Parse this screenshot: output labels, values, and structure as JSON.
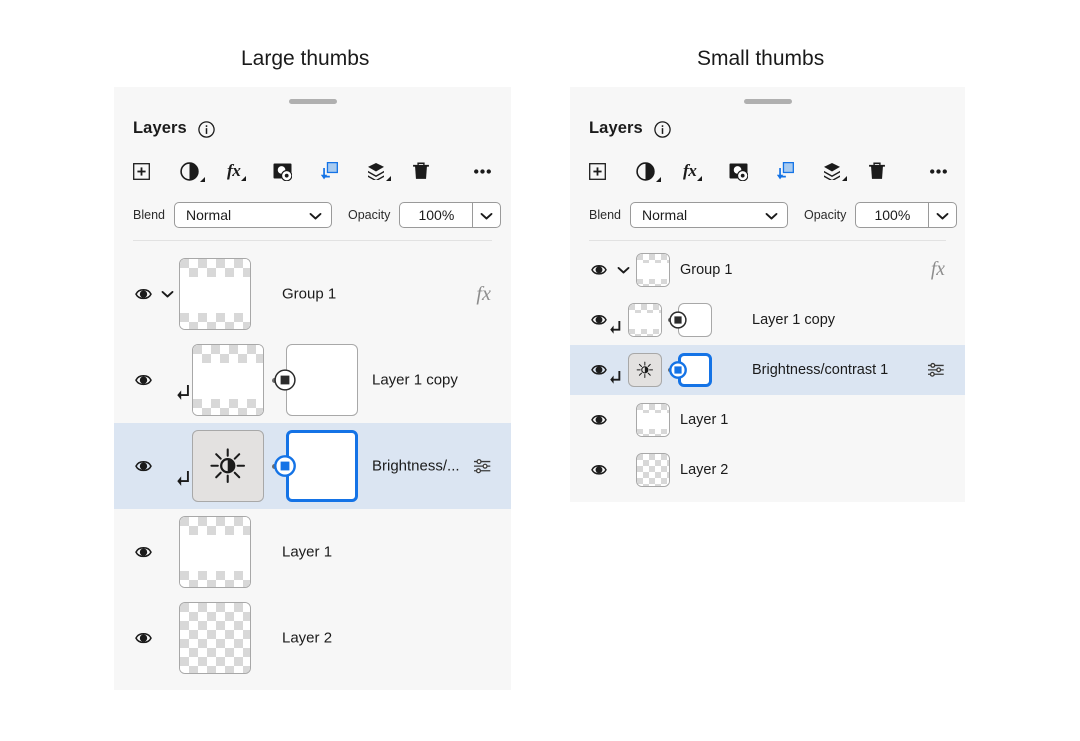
{
  "headings": {
    "large": "Large thumbs",
    "small": "Small thumbs"
  },
  "colors": {
    "panel_bg": "#f7f7f7",
    "selection": "#dbe5f2",
    "accent_blue": "#1473e6",
    "thumb_border": "#a8a8a8",
    "text": "#1b1b1b",
    "muted": "#8d8d8d"
  },
  "panel": {
    "title": "Layers",
    "info_icon": "info-circle-icon",
    "grabber": "drag-handle",
    "toolbar": [
      {
        "name": "add-layer-button",
        "icon": "plus-square-icon",
        "has_caret": false
      },
      {
        "name": "adjustment-layer-button",
        "icon": "half-circle-icon",
        "has_caret": true
      },
      {
        "name": "layer-effects-button",
        "icon": "fx-icon",
        "has_caret": true
      },
      {
        "name": "layer-mask-button",
        "icon": "mask-icon",
        "has_caret": false
      },
      {
        "name": "clipping-mask-button",
        "icon": "clip-square-icon",
        "has_caret": false
      },
      {
        "name": "group-layers-button",
        "icon": "stack-icon",
        "has_caret": true
      },
      {
        "name": "delete-layer-button",
        "icon": "trash-icon",
        "has_caret": false
      },
      {
        "name": "more-options-button",
        "icon": "ellipsis-icon",
        "has_caret": false
      }
    ],
    "properties": {
      "blend_label": "Blend",
      "blend_value": "Normal",
      "blend_options": [
        "Normal"
      ],
      "opacity_label": "Opacity",
      "opacity_value": "100%"
    }
  },
  "layers": [
    {
      "name": "Group 1",
      "visible": true,
      "visibility_icon": "eye-icon",
      "expanded": true,
      "expand_icon": "chevron-down-icon",
      "clipped": false,
      "thumb_type": "checker-frame",
      "has_mask": false,
      "mask_active": false,
      "selected": false,
      "right_icon": "fx-icon",
      "right_icon_label": "fx"
    },
    {
      "name": "Layer 1 copy",
      "visible": true,
      "visibility_icon": "eye-icon",
      "expanded": false,
      "clipped": true,
      "clip_icon": "clipping-arrow-icon",
      "thumb_type": "checker-frame",
      "has_mask": true,
      "mask_active": false,
      "mask_badge_icon": "mask-link-icon",
      "selected": false,
      "right_icon": null
    },
    {
      "name": "Brightness/contrast 1",
      "name_truncated": "Brightness/...",
      "visible": true,
      "visibility_icon": "eye-icon",
      "expanded": false,
      "clipped": true,
      "clip_icon": "clipping-arrow-icon",
      "thumb_type": "adjustment-brightness",
      "thumb_icon": "brightness-icon",
      "has_mask": true,
      "mask_active": true,
      "mask_badge_icon": "mask-link-icon",
      "selected": true,
      "right_icon": "sliders-icon"
    },
    {
      "name": "Layer 1",
      "visible": true,
      "visibility_icon": "eye-icon",
      "expanded": false,
      "clipped": false,
      "thumb_type": "checker-frame",
      "has_mask": false,
      "mask_active": false,
      "selected": false,
      "right_icon": null
    },
    {
      "name": "Layer 2",
      "visible": true,
      "visibility_icon": "eye-icon",
      "expanded": false,
      "clipped": false,
      "thumb_type": "checker-full",
      "has_mask": false,
      "mask_active": false,
      "selected": false,
      "right_icon": null
    }
  ]
}
